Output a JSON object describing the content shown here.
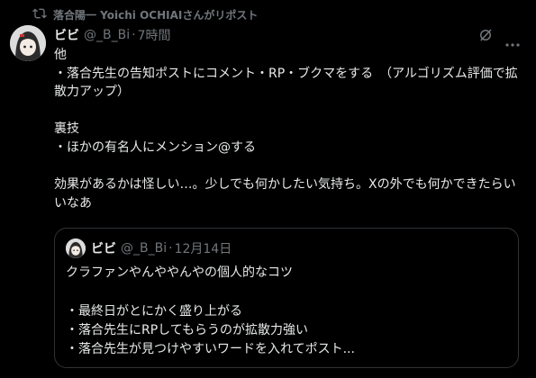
{
  "repost": {
    "text": "落合陽一 Yoichi OCHIAIさんがリポスト",
    "icon": "repost-icon"
  },
  "post": {
    "display_name": "ビビ",
    "handle": "@_B_Bi",
    "separator": "·",
    "time": "7時間",
    "body": "他\n・落合先生の告知ポストにコメント・RP・ブクマをする　（アルゴリズム評価で拡散力アップ）\n\n裏技\n・ほかの有名人にメンション@する\n\n効果があるかは怪しい…。少しでも何かしたい気持ち。Xの外でも何かできたらいいなあ",
    "icons": [
      "grok-icon",
      "more-icon"
    ]
  },
  "quote": {
    "display_name": "ビビ",
    "handle": "@_B_Bi",
    "separator": "·",
    "date": "12月14日",
    "body": "クラファンやんややんやの個人的なコツ\n\n・最終日がとにかく盛り上がる\n・落合先生にRPしてもらうのが拡散力強い\n・落合先生が見つけやすいワードを入れてポスト..."
  },
  "colors": {
    "background": "#000000",
    "text": "#e7e9ea",
    "muted": "#71767b",
    "border": "#2f3336"
  }
}
